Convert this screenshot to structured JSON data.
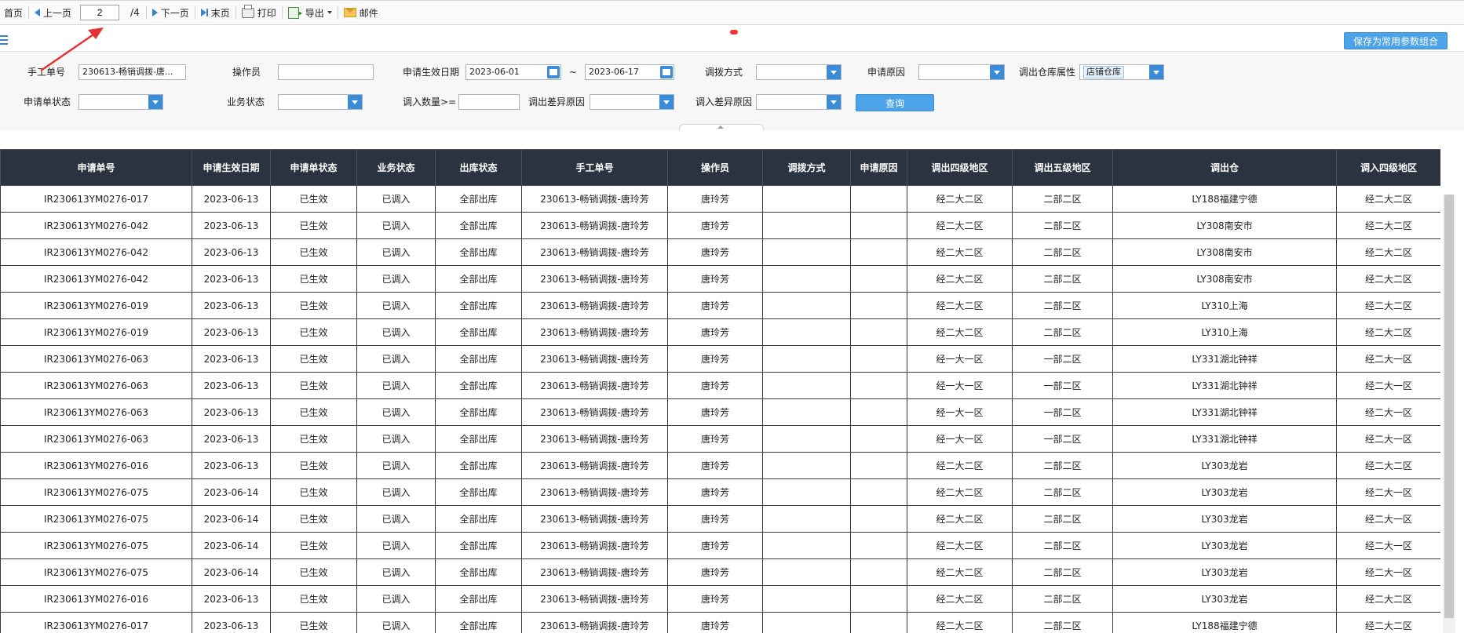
{
  "toolbar": {
    "first": "首页",
    "prev": "上一页",
    "page_value": "2",
    "page_total": "/4",
    "next": "下一页",
    "last": "末页",
    "print": "打印",
    "export": "导出",
    "mail": "邮件"
  },
  "save_combo_label": "保存为常用参数组合",
  "filters": {
    "manual_no_label": "手工单号",
    "manual_no_value": "230613-畅销调拨-唐...",
    "operator_label": "操作员",
    "operator_value": "",
    "effective_date_label": "申请生效日期",
    "date_from": "2023-06-01",
    "date_sep": "~",
    "date_to": "2023-06-17",
    "transfer_mode_label": "调拨方式",
    "reason_label": "申请原因",
    "out_warehouse_attr_label": "调出仓库属性",
    "out_warehouse_attr_value": "店铺仓库",
    "status_label": "申请单状态",
    "business_status_label": "业务状态",
    "in_qty_label": "调入数量>=",
    "out_diff_label": "调出差异原因",
    "in_diff_label": "调入差异原因",
    "query_btn": "查询"
  },
  "table": {
    "columns": [
      "申请单号",
      "申请生效日期",
      "申请单状态",
      "业务状态",
      "出库状态",
      "手工单号",
      "操作员",
      "调拨方式",
      "申请原因",
      "调出四级地区",
      "调出五级地区",
      "调出仓",
      "调入四级地区"
    ],
    "rows": [
      [
        "IR230613YM0276-017",
        "2023-06-13",
        "已生效",
        "已调入",
        "全部出库",
        "230613-畅销调拨-唐玲芳",
        "唐玲芳",
        "",
        "",
        "经二大二区",
        "二部二区",
        "LY188福建宁德",
        "经二大二区"
      ],
      [
        "IR230613YM0276-042",
        "2023-06-13",
        "已生效",
        "已调入",
        "全部出库",
        "230613-畅销调拨-唐玲芳",
        "唐玲芳",
        "",
        "",
        "经二大二区",
        "二部二区",
        "LY308南安市",
        "经二大二区"
      ],
      [
        "IR230613YM0276-042",
        "2023-06-13",
        "已生效",
        "已调入",
        "全部出库",
        "230613-畅销调拨-唐玲芳",
        "唐玲芳",
        "",
        "",
        "经二大二区",
        "二部二区",
        "LY308南安市",
        "经二大二区"
      ],
      [
        "IR230613YM0276-042",
        "2023-06-13",
        "已生效",
        "已调入",
        "全部出库",
        "230613-畅销调拨-唐玲芳",
        "唐玲芳",
        "",
        "",
        "经二大二区",
        "二部二区",
        "LY308南安市",
        "经二大二区"
      ],
      [
        "IR230613YM0276-019",
        "2023-06-13",
        "已生效",
        "已调入",
        "全部出库",
        "230613-畅销调拨-唐玲芳",
        "唐玲芳",
        "",
        "",
        "经二大二区",
        "二部二区",
        "LY310上海",
        "经二大二区"
      ],
      [
        "IR230613YM0276-019",
        "2023-06-13",
        "已生效",
        "已调入",
        "全部出库",
        "230613-畅销调拨-唐玲芳",
        "唐玲芳",
        "",
        "",
        "经二大二区",
        "二部二区",
        "LY310上海",
        "经二大二区"
      ],
      [
        "IR230613YM0276-063",
        "2023-06-13",
        "已生效",
        "已调入",
        "全部出库",
        "230613-畅销调拨-唐玲芳",
        "唐玲芳",
        "",
        "",
        "经一大一区",
        "一部二区",
        "LY331湖北钟祥",
        "经二大一区"
      ],
      [
        "IR230613YM0276-063",
        "2023-06-13",
        "已生效",
        "已调入",
        "全部出库",
        "230613-畅销调拨-唐玲芳",
        "唐玲芳",
        "",
        "",
        "经一大一区",
        "一部二区",
        "LY331湖北钟祥",
        "经二大一区"
      ],
      [
        "IR230613YM0276-063",
        "2023-06-13",
        "已生效",
        "已调入",
        "全部出库",
        "230613-畅销调拨-唐玲芳",
        "唐玲芳",
        "",
        "",
        "经一大一区",
        "一部二区",
        "LY331湖北钟祥",
        "经二大一区"
      ],
      [
        "IR230613YM0276-063",
        "2023-06-13",
        "已生效",
        "已调入",
        "全部出库",
        "230613-畅销调拨-唐玲芳",
        "唐玲芳",
        "",
        "",
        "经一大一区",
        "一部二区",
        "LY331湖北钟祥",
        "经二大一区"
      ],
      [
        "IR230613YM0276-016",
        "2023-06-13",
        "已生效",
        "已调入",
        "全部出库",
        "230613-畅销调拨-唐玲芳",
        "唐玲芳",
        "",
        "",
        "经二大二区",
        "二部二区",
        "LY303龙岩",
        "经二大二区"
      ],
      [
        "IR230613YM0276-075",
        "2023-06-14",
        "已生效",
        "已调入",
        "全部出库",
        "230613-畅销调拨-唐玲芳",
        "唐玲芳",
        "",
        "",
        "经二大二区",
        "二部二区",
        "LY303龙岩",
        "经二大一区"
      ],
      [
        "IR230613YM0276-075",
        "2023-06-14",
        "已生效",
        "已调入",
        "全部出库",
        "230613-畅销调拨-唐玲芳",
        "唐玲芳",
        "",
        "",
        "经二大二区",
        "二部二区",
        "LY303龙岩",
        "经二大一区"
      ],
      [
        "IR230613YM0276-075",
        "2023-06-14",
        "已生效",
        "已调入",
        "全部出库",
        "230613-畅销调拨-唐玲芳",
        "唐玲芳",
        "",
        "",
        "经二大二区",
        "二部二区",
        "LY303龙岩",
        "经二大一区"
      ],
      [
        "IR230613YM0276-075",
        "2023-06-14",
        "已生效",
        "已调入",
        "全部出库",
        "230613-畅销调拨-唐玲芳",
        "唐玲芳",
        "",
        "",
        "经二大二区",
        "二部二区",
        "LY303龙岩",
        "经二大一区"
      ],
      [
        "IR230613YM0276-016",
        "2023-06-13",
        "已生效",
        "已调入",
        "全部出库",
        "230613-畅销调拨-唐玲芳",
        "唐玲芳",
        "",
        "",
        "经二大二区",
        "二部二区",
        "LY303龙岩",
        "经二大二区"
      ],
      [
        "IR230613YM0276-017",
        "2023-06-13",
        "已生效",
        "已调入",
        "全部出库",
        "230613-畅销调拨-唐玲芳",
        "唐玲芳",
        "",
        "",
        "经二大二区",
        "二部二区",
        "LY188福建宁德",
        "经二大二区"
      ]
    ]
  },
  "colors": {
    "header_bg": "#2b3340",
    "button_blue": "#4ca3e8",
    "annotation_red": "#e33333"
  }
}
